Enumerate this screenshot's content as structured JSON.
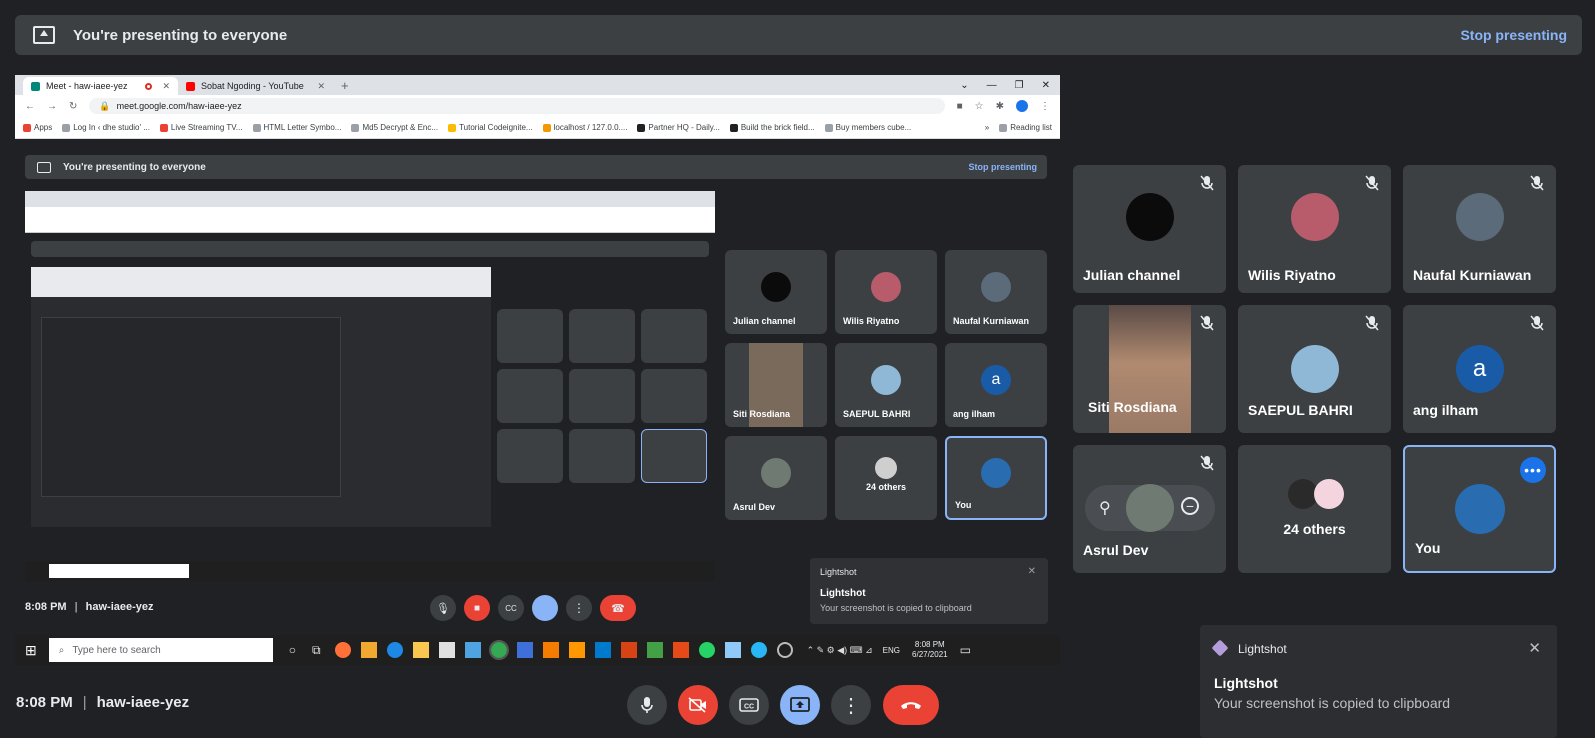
{
  "banner": {
    "title": "You're presenting to everyone",
    "stop_label": "Stop presenting"
  },
  "browser": {
    "tabs": [
      {
        "label": "Meet - haw-iaee-yez"
      },
      {
        "label": "Sobat Ngoding - YouTube"
      }
    ],
    "new_tab": "+",
    "url": "meet.google.com/haw-iaee-yez",
    "bookmarks": [
      "Apps",
      "Log In ‹ dhe studio' ...",
      "Live Streaming TV...",
      "HTML Letter Symbo...",
      "Md5 Decrypt & Enc...",
      "Tutorial Codeignite...",
      "localhost / 127.0.0....",
      "Partner HQ - Daily...",
      "Build the brick field...",
      "Buy members cube..."
    ],
    "bookmarks_more": "»",
    "reading_list": "Reading list"
  },
  "inner": {
    "banner_title": "You're presenting to everyone",
    "stop_label": "Stop presenting",
    "time": "8:08 PM",
    "meeting_code": "haw-iaee-yez",
    "taskbar_search": "Type here to search",
    "clock_time": "8:08 PM",
    "clock_date": "6/27/2021",
    "lang": "ENG",
    "toast_app": "Lightshot",
    "toast_title": "Lightshot",
    "toast_msg": "Your screenshot is copied to clipboard"
  },
  "participants": [
    {
      "name": "Julian channel",
      "muted": true,
      "avatar_color": "#0b0b0b"
    },
    {
      "name": "Wilis Riyatno",
      "muted": true,
      "avatar_color": "#b85c6c"
    },
    {
      "name": "Naufal Kurniawan",
      "muted": true,
      "avatar_color": "#5b6b7a"
    },
    {
      "name": "Siti Rosdiana",
      "muted": true,
      "avatar_color": "#7a6a5c"
    },
    {
      "name": "SAEPUL BAHRI",
      "muted": true,
      "avatar_color": "#8fb8d6"
    },
    {
      "name": "ang ilham",
      "muted": true,
      "avatar_color": "#1a5ba8",
      "initial": "a"
    },
    {
      "name": "Asrul Dev",
      "muted": true,
      "avatar_color": "#6f7a72"
    },
    {
      "name": "24 others",
      "muted": false,
      "avatar_color": "#cfcfcf"
    },
    {
      "name": "You",
      "muted": false,
      "avatar_color": "#2a6cb0"
    }
  ],
  "footer": {
    "time": "8:08 PM",
    "separator": "|",
    "meeting_code": "haw-iaee-yez"
  },
  "toast": {
    "app": "Lightshot",
    "title": "Lightshot",
    "message": "Your screenshot is copied to clipboard",
    "close": "✕"
  },
  "colors": {
    "background": "#202124",
    "tile": "#3c4043",
    "accent": "#8ab4f8",
    "danger": "#ea4335"
  }
}
